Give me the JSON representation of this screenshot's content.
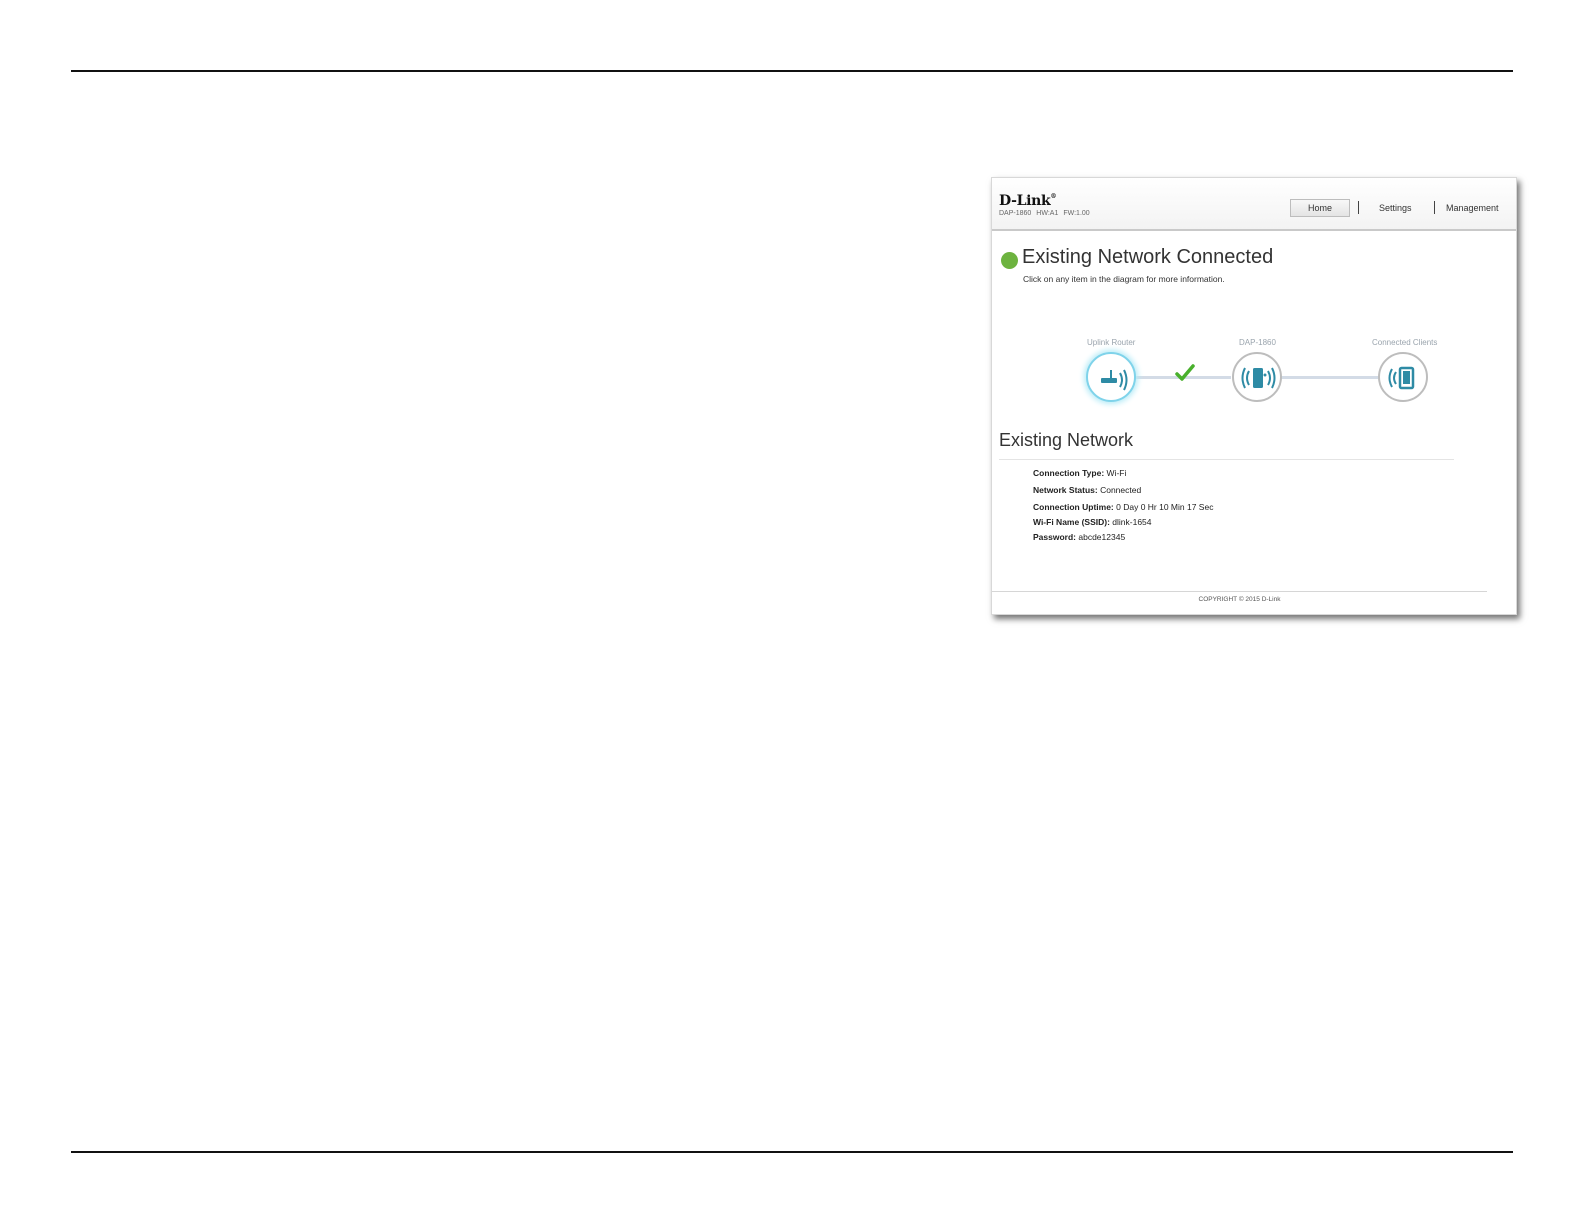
{
  "device": {
    "logo": "D-Link",
    "logo_mark": "®",
    "model": "DAP-1860",
    "hw": "HW:A1",
    "fw": "FW:1.00"
  },
  "nav": {
    "home": "Home",
    "settings": "Settings",
    "management": "Management"
  },
  "status": {
    "title": "Existing Network Connected",
    "subtitle": "Click on any item in the diagram for more information."
  },
  "diagram": {
    "uplink_label": "Uplink Router",
    "device_label": "DAP-1860",
    "clients_label": "Connected Clients"
  },
  "network": {
    "title": "Existing Network",
    "rows": [
      {
        "label": "Connection Type:",
        "value": "Wi-Fi"
      },
      {
        "label": "Network Status:",
        "value": "Connected"
      },
      {
        "label": "Connection Uptime:",
        "value": "0 Day 0 Hr 10 Min 17 Sec"
      },
      {
        "label": "Wi-Fi Name (SSID):",
        "value": "dlink-1654"
      },
      {
        "label": "Password:",
        "value": "abcde12345"
      }
    ]
  },
  "footer": {
    "copyright": "COPYRIGHT © 2015 D-Link"
  },
  "colors": {
    "status_green": "#6db33f",
    "icon_teal": "#2e8ba5",
    "active_glow": "#7fd3ea",
    "check_green": "#49b02c"
  }
}
